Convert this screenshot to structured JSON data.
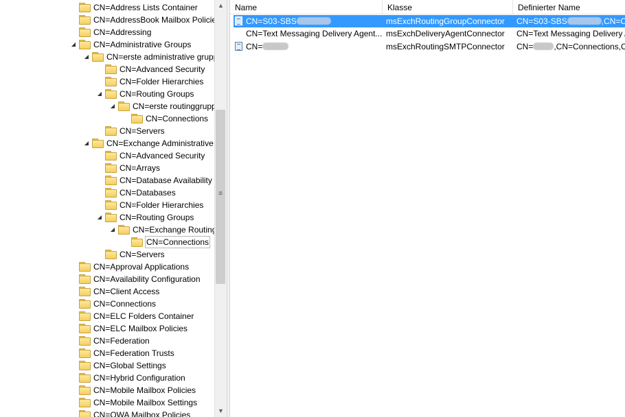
{
  "tree": {
    "items": [
      {
        "label": "CN=Address Lists Container",
        "expander": ""
      },
      {
        "label": "CN=AddressBook Mailbox Policies",
        "expander": ""
      },
      {
        "label": "CN=Addressing",
        "expander": ""
      },
      {
        "label": "CN=Administrative Groups",
        "expander": "◢"
      },
      {
        "label": "CN=erste administrative gruppe",
        "expander": "◢"
      },
      {
        "label": "CN=Advanced Security",
        "expander": ""
      },
      {
        "label": "CN=Folder Hierarchies",
        "expander": ""
      },
      {
        "label": "CN=Routing Groups",
        "expander": "◢"
      },
      {
        "label": "CN=erste routinggruppe",
        "expander": "◢"
      },
      {
        "label": "CN=Connections",
        "expander": ""
      },
      {
        "label": "CN=Servers",
        "expander": ""
      },
      {
        "label": "CN=Exchange Administrative Group",
        "expander": "◢"
      },
      {
        "label": "CN=Advanced Security",
        "expander": ""
      },
      {
        "label": "CN=Arrays",
        "expander": ""
      },
      {
        "label": "CN=Database Availability Groups",
        "expander": ""
      },
      {
        "label": "CN=Databases",
        "expander": ""
      },
      {
        "label": "CN=Folder Hierarchies",
        "expander": ""
      },
      {
        "label": "CN=Routing Groups",
        "expander": "◢"
      },
      {
        "label": "CN=Exchange Routing Group",
        "expander": "◢"
      },
      {
        "label": "CN=Connections",
        "expander": ""
      },
      {
        "label": "CN=Servers",
        "expander": ""
      },
      {
        "label": "CN=Approval Applications",
        "expander": ""
      },
      {
        "label": "CN=Availability Configuration",
        "expander": ""
      },
      {
        "label": "CN=Client Access",
        "expander": ""
      },
      {
        "label": "CN=Connections",
        "expander": ""
      },
      {
        "label": "CN=ELC Folders Container",
        "expander": ""
      },
      {
        "label": "CN=ELC Mailbox Policies",
        "expander": ""
      },
      {
        "label": "CN=Federation",
        "expander": ""
      },
      {
        "label": "CN=Federation Trusts",
        "expander": ""
      },
      {
        "label": "CN=Global Settings",
        "expander": ""
      },
      {
        "label": "CN=Hybrid Configuration",
        "expander": ""
      },
      {
        "label": "CN=Mobile Mailbox Policies",
        "expander": ""
      },
      {
        "label": "CN=Mobile Mailbox Settings",
        "expander": ""
      },
      {
        "label": "CN=OWA Mailbox Policies",
        "expander": ""
      }
    ],
    "scroll_up_glyph": "▲",
    "scroll_down_glyph": "▼",
    "scroll_grip_glyph": "≡"
  },
  "list": {
    "columns": [
      {
        "label": "Name"
      },
      {
        "label": "Klasse"
      },
      {
        "label": "Definierter Name"
      }
    ],
    "rows": [
      {
        "name_prefix": "CN=S03-SBS",
        "klasse": "msExchRoutingGroupConnector",
        "dn_prefix": "CN=S03-SBS",
        "dn_suffix": ",CN=Connections,CN=Exchange Routing Group"
      },
      {
        "name_prefix": "CN=Text Messaging Delivery Agent...",
        "klasse": "msExchDeliveryAgentConnector",
        "dn_prefix": "CN=Text Messaging Delivery Agent",
        "dn_suffix": ""
      },
      {
        "name_prefix": "CN=",
        "klasse": "msExchRoutingSMTPConnector",
        "dn_prefix": "CN=",
        "dn_suffix": ",CN=Connections,CN=Exchange Routing Group"
      }
    ]
  },
  "colors": {
    "selection": "#3399ff",
    "folder": "#f4cf62"
  }
}
